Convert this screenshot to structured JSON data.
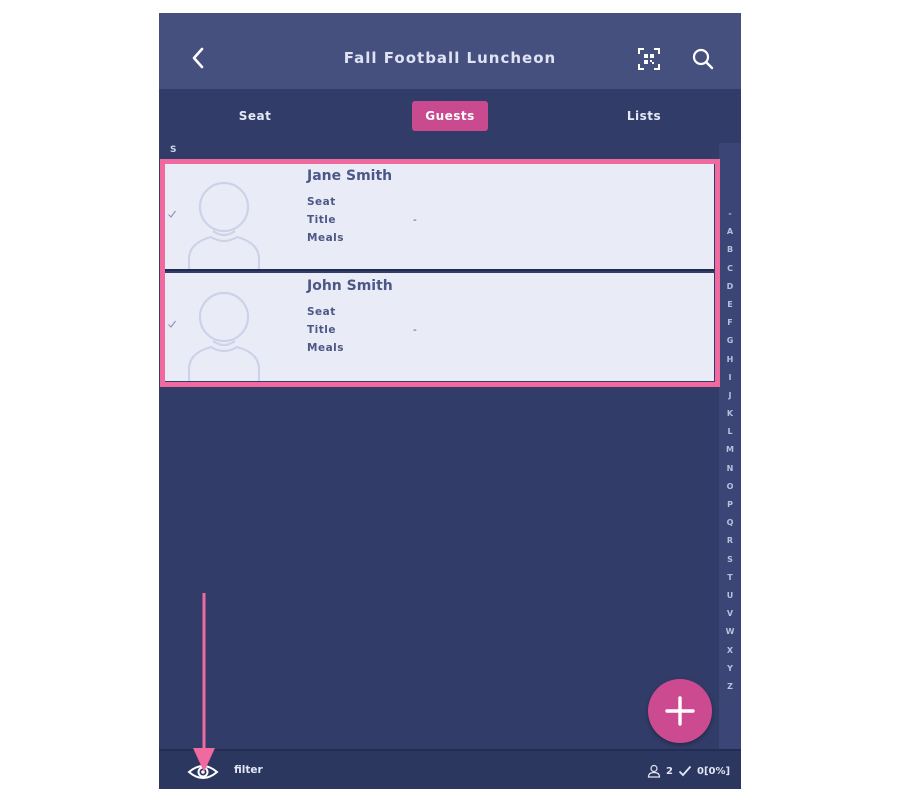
{
  "header": {
    "title": "Fall Football Luncheon",
    "back_icon": "chevron-left-icon",
    "qr_icon": "qr-scan-icon",
    "search_icon": "search-icon"
  },
  "tabs": [
    {
      "label": "Seat",
      "active": false
    },
    {
      "label": "Guests",
      "active": true
    },
    {
      "label": "Lists",
      "active": false
    }
  ],
  "list": {
    "section_letter": "S",
    "guests": [
      {
        "name": "Jane Smith",
        "seat_label": "Seat",
        "title_label": "Title",
        "title_value": "-",
        "meals_label": "Meals"
      },
      {
        "name": "John Smith",
        "seat_label": "Seat",
        "title_label": "Title",
        "title_value": "-",
        "meals_label": "Meals"
      }
    ]
  },
  "alpha_index": [
    "-",
    "A",
    "B",
    "C",
    "D",
    "E",
    "F",
    "G",
    "H",
    "I",
    "J",
    "K",
    "L",
    "M",
    "N",
    "O",
    "P",
    "Q",
    "R",
    "S",
    "T",
    "U",
    "V",
    "W",
    "X",
    "Y",
    "Z"
  ],
  "footer": {
    "filter_label": "filter",
    "guest_count": "2",
    "checked_count": "0",
    "checked_percent": "[0%]"
  },
  "colors": {
    "accent": "#c94a8e",
    "highlight": "#f06aa0",
    "background": "#313c68",
    "header": "#45507f"
  }
}
